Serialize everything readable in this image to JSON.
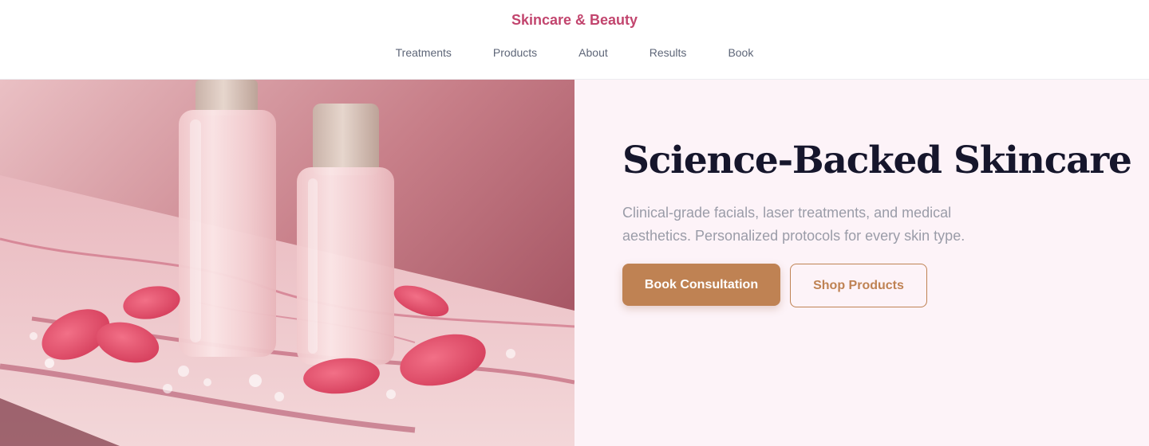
{
  "brand": {
    "name": "Skincare & Beauty"
  },
  "nav": {
    "items": [
      {
        "label": "Treatments"
      },
      {
        "label": "Products"
      },
      {
        "label": "About"
      },
      {
        "label": "Results"
      },
      {
        "label": "Book"
      }
    ]
  },
  "hero": {
    "title": "Science-Backed Skincare",
    "subtitle": "Clinical-grade facials, laser treatments, and medical aesthetics. Personalized protocols for every skin type.",
    "primary_cta": "Book Consultation",
    "secondary_cta": "Shop Products",
    "image": {
      "subject": "two frosted pink serum bottles with rose petals on pink marble"
    }
  },
  "colors": {
    "brand": "#c2456e",
    "accent": "#bf8253",
    "heading": "#16162c",
    "muted": "#9a9ca8",
    "panel_bg": "#fdf3f8"
  }
}
